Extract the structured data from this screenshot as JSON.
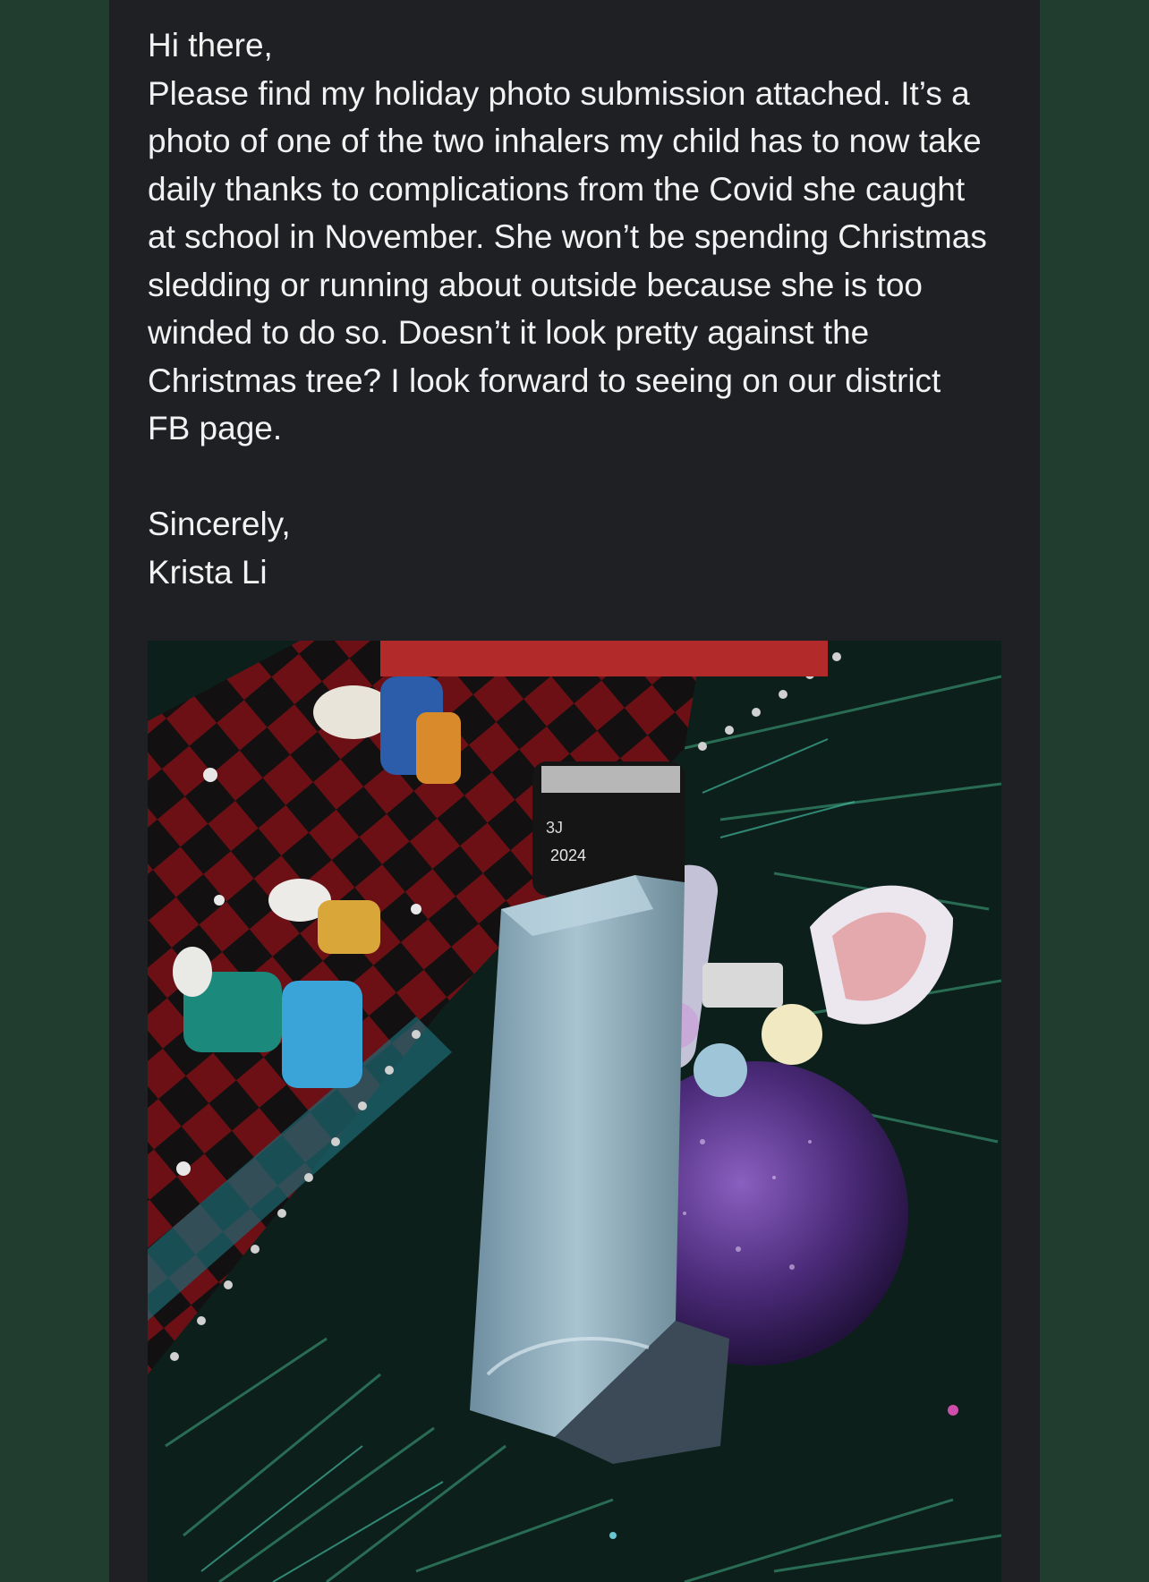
{
  "message": {
    "greeting": "Hi there,",
    "body": "Please find my holiday photo submission attached. It’s a photo of one of the two inhalers my child has to now take daily thanks to complications from the Covid she caught at school in November. She won’t be spending Christmas sledding or running about outside because she is too winded to do so. Doesn’t it look pretty against the Christmas tree? I look forward to seeing on our district FB page.",
    "signoff": "Sincerely,",
    "signature": "Krista Li"
  },
  "photo": {
    "subject": "inhaler-on-christmas-tree",
    "canister_text_1": "3J",
    "canister_text_2": "2024"
  },
  "colors": {
    "page_background": "#213d2f",
    "panel_background": "#1f2024",
    "text": "#f2f2f2"
  }
}
